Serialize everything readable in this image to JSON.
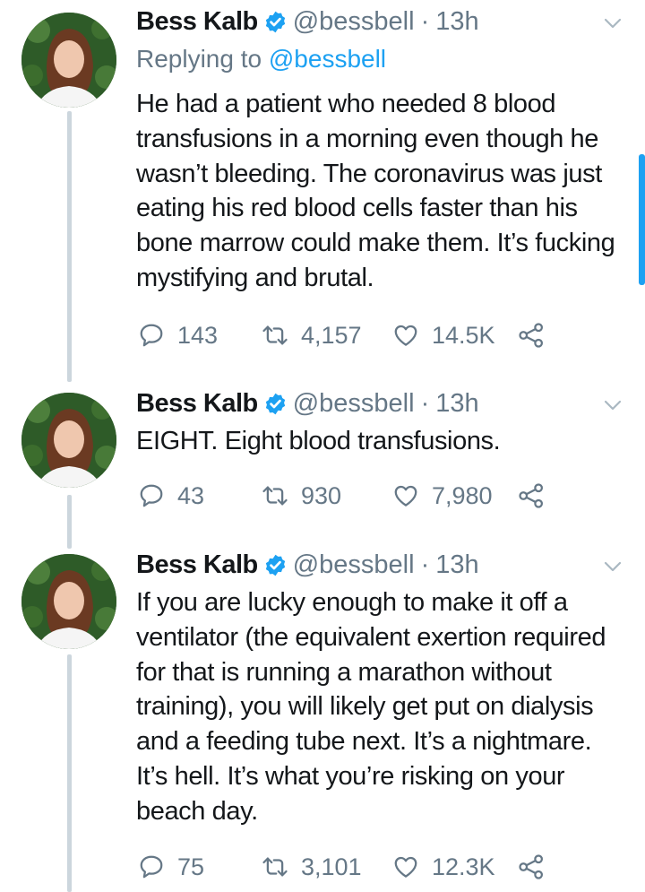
{
  "tweets": [
    {
      "name": "Bess Kalb",
      "handle": "@bessbell",
      "dot": "·",
      "time": "13h",
      "reply_prefix": "Replying to",
      "reply_mention": "@bessbell",
      "text": "He had a patient who needed 8 blood transfusions in a morning even though he wasn’t bleeding. The coronavirus was just eating his red blood cells faster than his bone marrow could make them. It’s fucking mystifying and brutal.",
      "replies": "143",
      "retweets": "4,157",
      "likes": "14.5K"
    },
    {
      "name": "Bess Kalb",
      "handle": "@bessbell",
      "dot": "·",
      "time": "13h",
      "text": "EIGHT. Eight blood transfusions.",
      "replies": "43",
      "retweets": "930",
      "likes": "7,980"
    },
    {
      "name": "Bess Kalb",
      "handle": "@bessbell",
      "dot": "·",
      "time": "13h",
      "text": "If you are lucky enough to make it off a ventilator (the equivalent exertion required for that is running a marathon without training), you will likely get put on dialysis and a feeding tube next. It’s a nightmare. It’s hell. It’s what you’re risking on your beach day.",
      "replies": "75",
      "retweets": "3,101",
      "likes": "12.3K"
    }
  ],
  "icons": {
    "verified": "verified-badge-icon",
    "chevron": "chevron-down-icon",
    "reply": "reply-icon",
    "retweet": "retweet-icon",
    "like": "heart-icon",
    "share": "share-icon"
  },
  "colors": {
    "text": "#14171a",
    "muted": "#657786",
    "accent": "#1da1f2",
    "thread_line": "#ccd6dd"
  }
}
